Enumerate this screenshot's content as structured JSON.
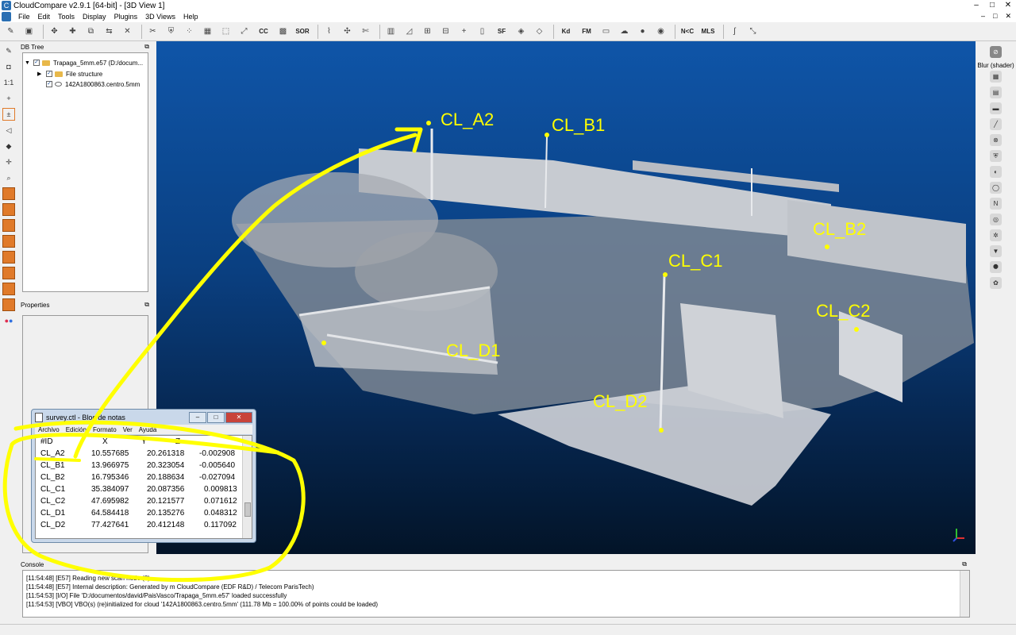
{
  "window": {
    "title": "CloudCompare v2.9.1 [64-bit] - [3D View 1]",
    "minimize": "–",
    "restore": "□",
    "close": "✕"
  },
  "menu": {
    "items": [
      "File",
      "Edit",
      "Tools",
      "Display",
      "Plugins",
      "3D Views",
      "Help"
    ]
  },
  "toolbar": {
    "sor_label": "SOR",
    "sf_label": "SF",
    "kd_label": "Kd",
    "fm_label": "FM",
    "ncc_label": "N<C",
    "mls_label": "MLS",
    "cc_label": "CC"
  },
  "dbtree": {
    "title": "DB Tree",
    "root": "Trapaga_5mm.e57 (D:/docum...",
    "child1": "File structure",
    "child2": "142A1800863.centro.5mm"
  },
  "properties": {
    "title": "Properties"
  },
  "right_panel": {
    "blur_label": "Blur (shader)"
  },
  "labels3d": {
    "a2": "CL_A2",
    "b1": "CL_B1",
    "b2": "CL_B2",
    "c1": "CL_C1",
    "c2": "CL_C2",
    "d1": "CL_D1",
    "d2": "CL_D2"
  },
  "notepad": {
    "title": "survey.ctl - Bloc de notas",
    "menu": [
      "Archivo",
      "Edición",
      "Formato",
      "Ver",
      "Ayuda"
    ],
    "header": [
      "#ID",
      "X",
      "Y",
      "Z"
    ],
    "rows": [
      [
        "CL_A2",
        "10.557685",
        "20.261318",
        "-0.002908"
      ],
      [
        "CL_B1",
        "13.966975",
        "20.323054",
        "-0.005640"
      ],
      [
        "CL_B2",
        "16.795346",
        "20.188634",
        "-0.027094"
      ],
      [
        "CL_C1",
        "35.384097",
        "20.087356",
        "0.009813"
      ],
      [
        "CL_C2",
        "47.695982",
        "20.121577",
        "0.071612"
      ],
      [
        "CL_D1",
        "64.584418",
        "20.135276",
        "0.048312"
      ],
      [
        "CL_D2",
        "77.427641",
        "20.412148",
        "0.117092"
      ]
    ]
  },
  "console": {
    "title": "Console",
    "lines": [
      "[11:54:48] [E57] Reading new scan node (0)",
      "[11:54:48] [E57] Internal description: Generated by m CloudCompare (EDF R&D) / Telecom ParisTech)",
      "[11:54:53] [I/O] File 'D:/documentos/david/PaisVasco/Trapaga_5mm.e57' loaded successfully",
      "[11:54:53] [VBO] VBO(s) (re)initialized for cloud '142A1800863.centro.5mm' (111.78 Mb = 100.00% of points could be loaded)"
    ]
  },
  "colors": {
    "annotation": "#ffff00",
    "viewport_top": "#0f55a8",
    "viewport_bottom": "#031428"
  }
}
